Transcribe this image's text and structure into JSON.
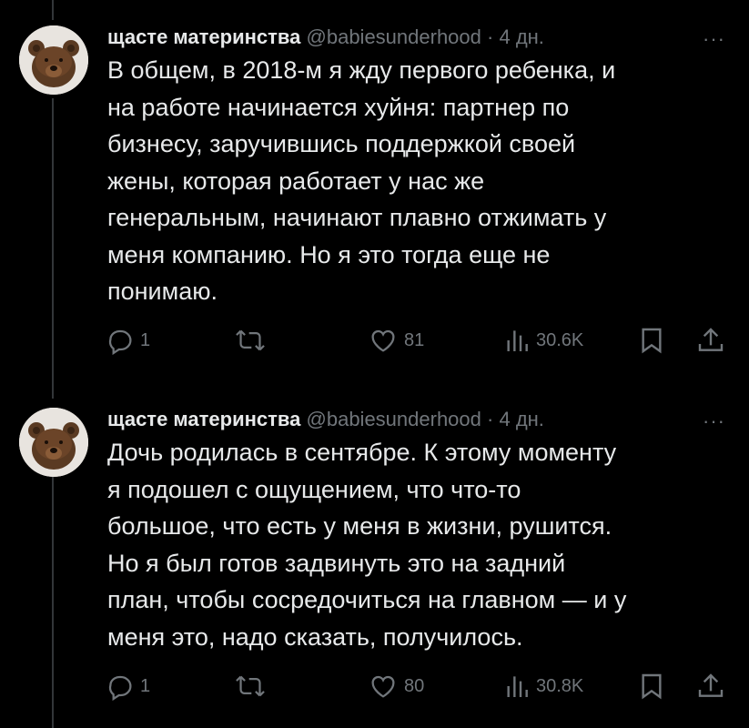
{
  "tweets": [
    {
      "author_name": "щасте материнства",
      "handle": "@babiesunderhood",
      "time": "4 дн.",
      "more": "···",
      "text": "В общем, в 2018-м я жду первого ребенка, и\nна работе начинается хуйня: партнер по\nбизнесу, заручившись поддержкой своей\nжены, которая работает у нас же\nгенеральным, начинают плавно отжимать у\nменя компанию. Но я это тогда еще не\nпонимаю.",
      "replies": "1",
      "retweets": "",
      "likes": "81",
      "views": "30.6K"
    },
    {
      "author_name": "щасте материнства",
      "handle": "@babiesunderhood",
      "time": "4 дн.",
      "more": "···",
      "text": "Дочь родилась в сентябре. К этому моменту\nя подошел с ощущением, что что-то\nбольшое, что есть у меня в жизни, рушится.\nНо я был готов задвинуть это на задний\nплан, чтобы сосредочиться на главном — и у\nменя это, надо сказать, получилось.",
      "replies": "1",
      "retweets": "",
      "likes": "80",
      "views": "30.8K"
    }
  ],
  "separator": "·",
  "colors": {
    "background": "#000000",
    "text": "#e7e9ea",
    "muted": "#71767b",
    "thread_line": "#333639"
  },
  "icons": [
    "reply-icon",
    "retweet-icon",
    "like-icon",
    "views-icon",
    "bookmark-icon",
    "share-icon",
    "more-icon",
    "avatar-bear"
  ]
}
